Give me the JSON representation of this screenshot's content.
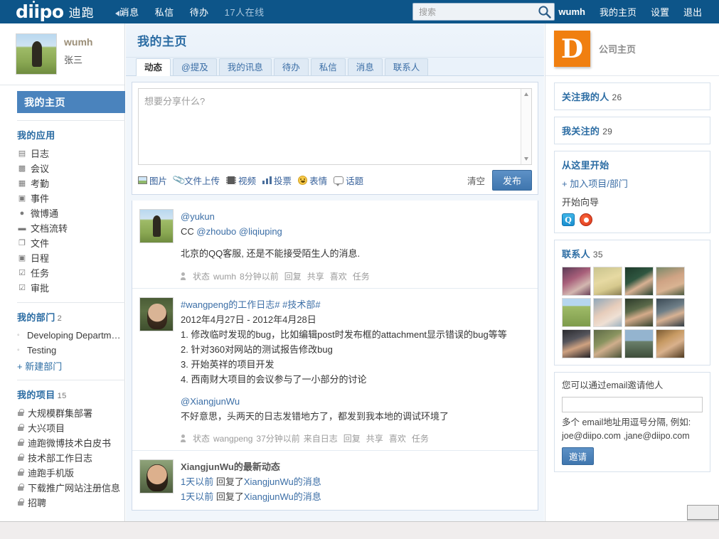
{
  "topbar": {
    "logo_text": "diipo",
    "logo_cn": "迪跑",
    "nav": [
      {
        "label": "消息",
        "icon": "speaker-icon"
      },
      {
        "label": "私信",
        "icon": ""
      },
      {
        "label": "待办",
        "icon": ""
      }
    ],
    "online": "17人在线",
    "search": {
      "placeholder": "搜索",
      "value": "",
      "icon": "search-icon"
    },
    "right": [
      {
        "label": "wumh",
        "name": "username-link"
      },
      {
        "label": "我的主页",
        "name": "my-home-link"
      },
      {
        "label": "设置",
        "name": "settings-link"
      },
      {
        "label": "退出",
        "name": "logout-link"
      }
    ]
  },
  "sidebar": {
    "profile": {
      "username": "wumh",
      "realname": "张三"
    },
    "active_item": "我的主页",
    "apps": {
      "title": "我的应用",
      "items": [
        {
          "label": "日志",
          "icon": "book-icon"
        },
        {
          "label": "会议",
          "icon": "meeting-icon"
        },
        {
          "label": "考勤",
          "icon": "attendance-icon"
        },
        {
          "label": "事件",
          "icon": "event-icon"
        },
        {
          "label": "微博通",
          "icon": "weibo-icon"
        },
        {
          "label": "文档流转",
          "icon": "folder-icon"
        },
        {
          "label": "文件",
          "icon": "file-icon"
        },
        {
          "label": "日程",
          "icon": "calendar-icon"
        },
        {
          "label": "任务",
          "icon": "checkbox-icon"
        },
        {
          "label": "审批",
          "icon": "approval-icon"
        }
      ]
    },
    "departments": {
      "title": "我的部门",
      "count": "2",
      "items": [
        {
          "label": "Developing Departm…"
        },
        {
          "label": "Testing"
        }
      ],
      "new_link": "+ 新建部门"
    },
    "projects": {
      "title": "我的项目",
      "count": "15",
      "items": [
        {
          "label": "大规模群集部署"
        },
        {
          "label": "大兴项目"
        },
        {
          "label": "迪跑微博技术白皮书"
        },
        {
          "label": "技术部工作日志"
        },
        {
          "label": "迪跑手机版"
        },
        {
          "label": "下载推广网站注册信息"
        },
        {
          "label": "招聘"
        }
      ]
    }
  },
  "main": {
    "page_title": "我的主页",
    "tabs": [
      {
        "label": "动态",
        "active": true
      },
      {
        "label": "@提及",
        "active": false
      },
      {
        "label": "我的讯息",
        "active": false
      },
      {
        "label": "待办",
        "active": false
      },
      {
        "label": "私信",
        "active": false
      },
      {
        "label": "消息",
        "active": false
      },
      {
        "label": "联系人",
        "active": false
      }
    ],
    "composer": {
      "placeholder": "想要分享什么?",
      "value": "",
      "tools": [
        {
          "label": "图片",
          "icon": "image-icon"
        },
        {
          "label": "文件上传",
          "icon": "paperclip-icon"
        },
        {
          "label": "视频",
          "icon": "video-icon"
        },
        {
          "label": "投票",
          "icon": "poll-icon"
        },
        {
          "label": "表情",
          "icon": "smiley-icon"
        },
        {
          "label": "话题",
          "icon": "topic-icon"
        }
      ],
      "clear_label": "清空",
      "publish_label": "发布"
    },
    "posts": [
      {
        "mention": "@yukun",
        "cc_label": "CC",
        "cc": [
          "@zhoubo",
          "@liqiuping"
        ],
        "text": "北京的QQ客服, 还是不能接受陌生人的消息.",
        "meta": {
          "type": "状态",
          "author": "wumh",
          "time": "8分钟以前",
          "source": "",
          "actions": [
            "回复",
            "共享",
            "喜欢",
            "任务"
          ]
        }
      },
      {
        "tags": [
          "#wangpeng的工作日志#",
          "#技术部#"
        ],
        "date_range": "2012年4月27日 - 2012年4月28日",
        "lines": [
          "1. 修改临时发现的bug，比如编辑post时发布框的attachment显示错误的bug等等",
          "2. 针对360对网站的测试报告修改bug",
          "3. 开始英祥的项目开发",
          "4. 西南财大项目的会议参与了一小部分的讨论"
        ],
        "reply_mention": "@XiangjunWu",
        "reply_text": "不好意思，头两天的日志发错地方了，都发到我本地的调试环境了",
        "meta": {
          "type": "状态",
          "author": "wangpeng",
          "time": "37分钟以前",
          "source": "来自日志",
          "actions": [
            "回复",
            "共享",
            "喜欢",
            "任务"
          ]
        }
      },
      {
        "title": "XiangjunWu的最新动态",
        "activities": [
          {
            "time": "1天以前",
            "verb": "回复了",
            "target": "XiangjunWu",
            "suffix": "的消息"
          },
          {
            "time": "1天以前",
            "verb": "回复了",
            "target": "XiangjunWu",
            "suffix": "的消息"
          }
        ]
      }
    ]
  },
  "right": {
    "company": {
      "logo_letter": "D",
      "label": "公司主页"
    },
    "followers": {
      "title": "关注我的人",
      "count": "26"
    },
    "following": {
      "title": "我关注的",
      "count": "29"
    },
    "start_here": {
      "title": "从这里开始",
      "join_link": "+ 加入项目/部门",
      "guide_link": "开始向导",
      "socials": [
        {
          "name": "tencent-weibo-icon",
          "glyph": "Q"
        },
        {
          "name": "sina-weibo-icon",
          "glyph": ""
        }
      ]
    },
    "contacts": {
      "title": "联系人",
      "count": "35",
      "avatars": [
        "contact-avatar-1",
        "contact-avatar-2",
        "contact-avatar-3",
        "contact-avatar-4",
        "contact-avatar-5",
        "contact-avatar-6",
        "contact-avatar-7",
        "contact-avatar-8",
        "contact-avatar-9",
        "contact-avatar-10",
        "contact-avatar-11",
        "contact-avatar-12"
      ]
    },
    "invite": {
      "label": "您可以通过email邀请他人",
      "input_value": "",
      "hint": "多个 email地址用逗号分隔, 例如:",
      "example": "joe@diipo.com ,jane@diipo.com",
      "button": "邀请"
    }
  },
  "colors": {
    "topbar": "#0d5589",
    "accent_blue": "#2b6ca3",
    "active_item": "#4a83bd",
    "company_orange": "#f07f10",
    "feed_bg": "#f1f6fb"
  }
}
